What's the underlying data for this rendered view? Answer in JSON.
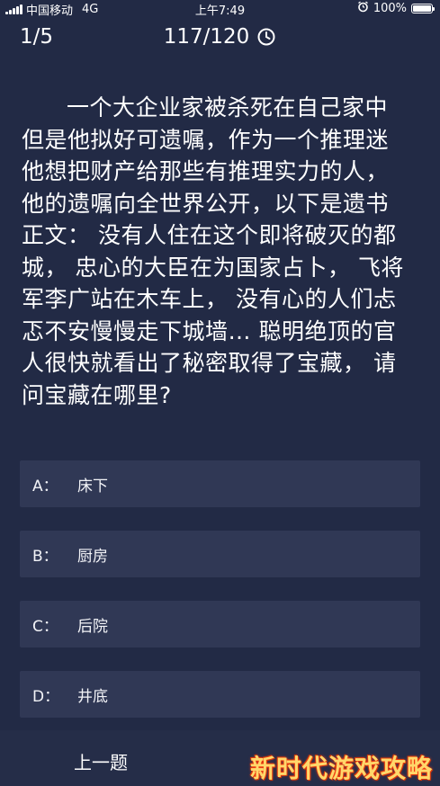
{
  "status_bar": {
    "carrier": "中国移动",
    "network": "4G",
    "time": "上午7:49",
    "battery_text": "100%",
    "alarm_icon": "alarm-clock-icon"
  },
  "header": {
    "progress": "1/5",
    "score": "117/120",
    "timer_icon": "clock-icon"
  },
  "question": {
    "text": "一个大企业家被杀死在自己家中但是他拟好可遗嘱，作为一个推理迷他想把财产给那些有推理实力的人，他的遗嘱向全世界公开，以下是遗书正文： 没有人住在这个即将破灭的都城， 忠心的大臣在为国家占卜， 飞将军李广站在木车上， 没有心的人们忐忑不安慢慢走下城墙… 聪明绝顶的官人很快就看出了秘密取得了宝藏， 请问宝藏在哪里?"
  },
  "options": [
    {
      "letter": "A：",
      "text": "床下"
    },
    {
      "letter": "B：",
      "text": "厨房"
    },
    {
      "letter": "C：",
      "text": "后院"
    },
    {
      "letter": "D：",
      "text": "井底"
    }
  ],
  "footer": {
    "prev_label": "上一题",
    "watermark": "新时代游戏攻略"
  },
  "colors": {
    "background": "#222a45",
    "option_bg": "#303855",
    "text": "#ffffff"
  }
}
